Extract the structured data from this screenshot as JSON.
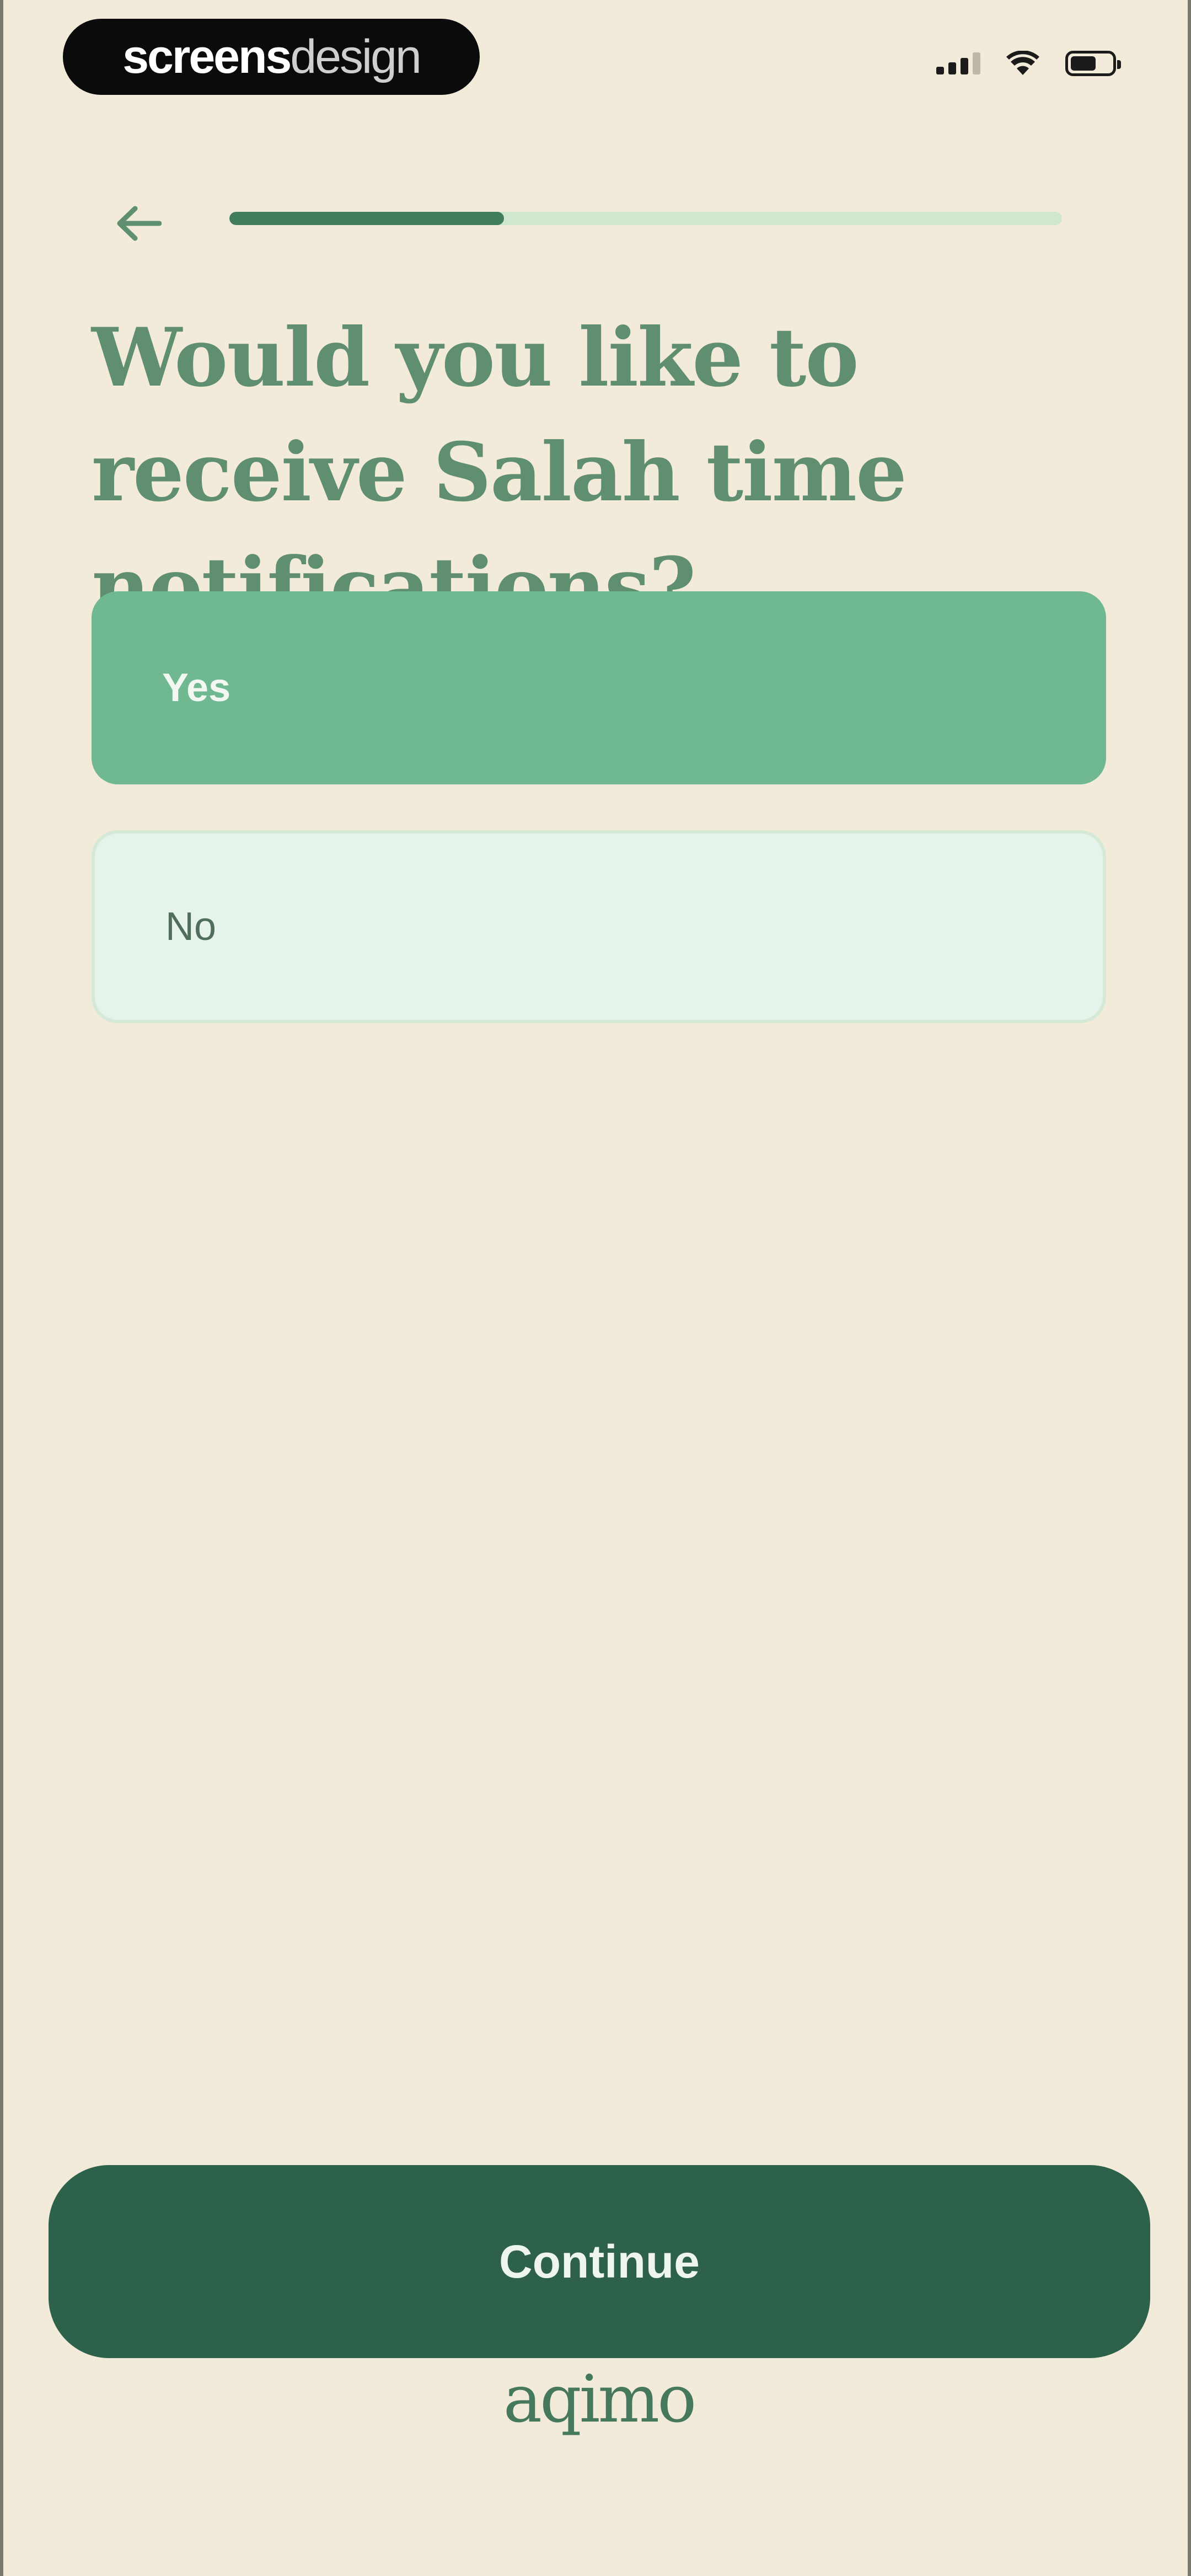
{
  "status_bar": {
    "brand_bold": "screens",
    "brand_light": "design",
    "icons": [
      "signal-icon",
      "wifi-icon",
      "battery-icon"
    ]
  },
  "header": {
    "back_icon": "arrow-left-icon",
    "progress_fraction": 0.33
  },
  "question": {
    "title": "Would you like to receive Salah time notifications?"
  },
  "options": [
    {
      "label": "Yes",
      "selected": true
    },
    {
      "label": "No",
      "selected": false
    }
  ],
  "footer": {
    "continue_label": "Continue",
    "wordmark": "aqimo"
  },
  "colors": {
    "background": "#f2ebda",
    "accent_dark": "#2d614c",
    "accent_selected": "#6fb892",
    "option_unselected": "#e6f3ea",
    "title": "#5f8f70"
  }
}
